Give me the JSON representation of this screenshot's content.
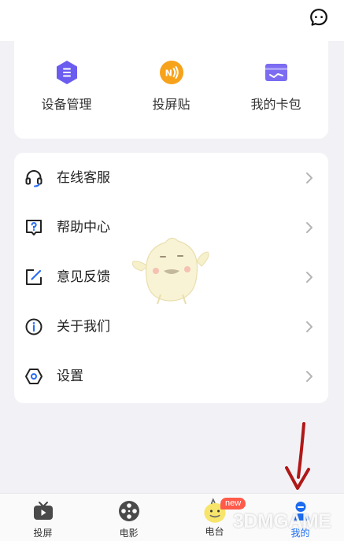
{
  "header": {
    "chat_icon": "chat-bubble-icon"
  },
  "tools": [
    {
      "label": "设备管理",
      "icon": "device-management-icon",
      "color": "#6b5cf0"
    },
    {
      "label": "投屏贴",
      "icon": "nfc-sticker-icon",
      "color": "#f7a21b"
    },
    {
      "label": "我的卡包",
      "icon": "card-wallet-icon",
      "color": "#7b6cf2"
    }
  ],
  "menu": [
    {
      "label": "在线客服",
      "icon": "headset-icon"
    },
    {
      "label": "帮助中心",
      "icon": "help-question-icon"
    },
    {
      "label": "意见反馈",
      "icon": "feedback-edit-icon"
    },
    {
      "label": "关于我们",
      "icon": "about-info-icon"
    },
    {
      "label": "设置",
      "icon": "settings-hexagon-icon"
    }
  ],
  "bottom_nav": [
    {
      "label": "投屏",
      "icon": "tv-icon",
      "active": false
    },
    {
      "label": "电影",
      "icon": "film-reel-icon",
      "active": false
    },
    {
      "label": "电台",
      "icon": "radio-mascot-icon",
      "active": false,
      "badge": "new"
    },
    {
      "label": "我的",
      "icon": "person-icon",
      "active": true
    }
  ],
  "watermark": "3DMGAME",
  "colors": {
    "accent": "#1c6bf0",
    "annotation_arrow": "#b01818",
    "badge": "#ff5a4a",
    "background": "#f2f2f6"
  }
}
